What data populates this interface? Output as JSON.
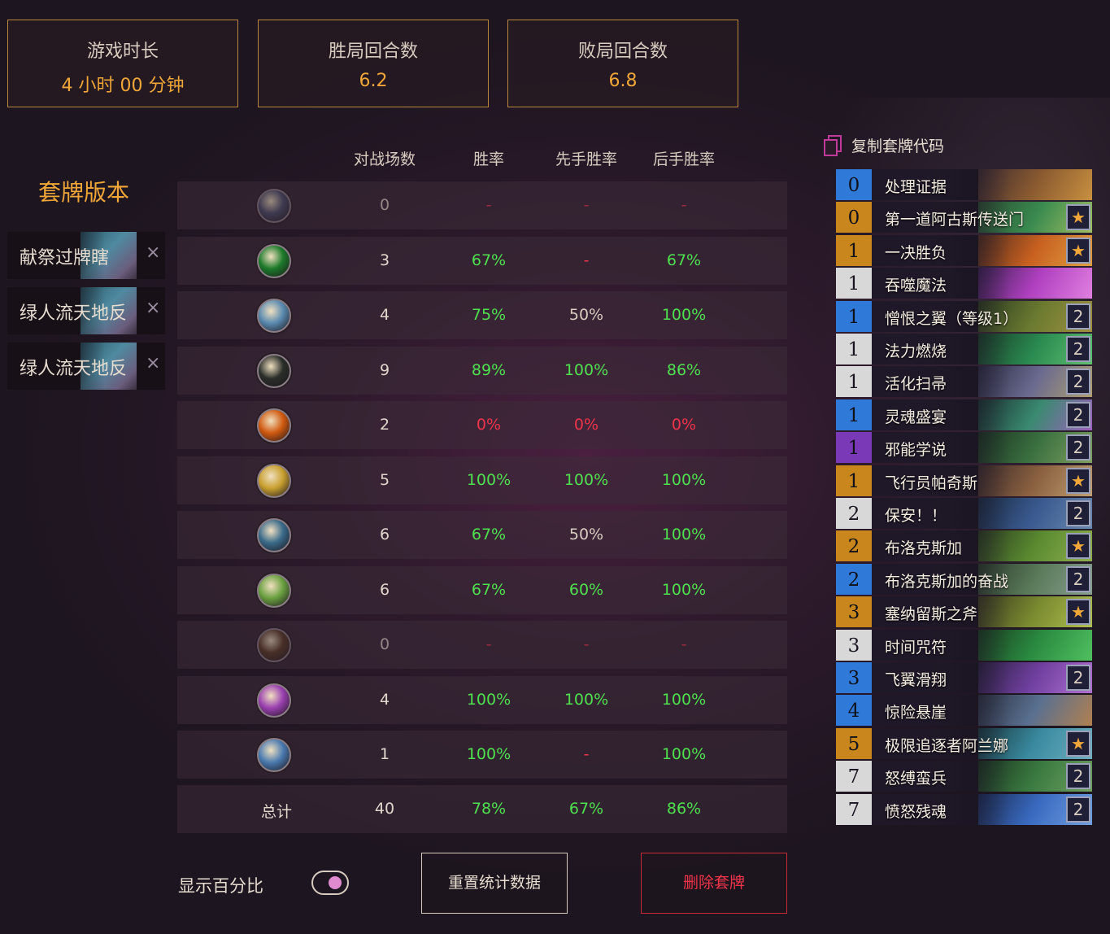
{
  "stats": {
    "duration": {
      "label": "游戏时长",
      "value": "4 小时 00 分钟"
    },
    "win_turns": {
      "label": "胜局回合数",
      "value": "6.2"
    },
    "loss_turns": {
      "label": "败局回合数",
      "value": "6.8"
    }
  },
  "versions": {
    "title": "套牌版本",
    "items": [
      {
        "name": "献祭过牌瞎"
      },
      {
        "name": "绿人流天地反"
      },
      {
        "name": "绿人流天地反"
      }
    ],
    "remove_glyph": "×"
  },
  "table": {
    "headers": {
      "games": "对战场数",
      "winrate": "胜率",
      "first": "先手胜率",
      "second": "后手胜率"
    },
    "rows": [
      {
        "icon": "death-knight-class-icon",
        "games": "0",
        "winrate": "-",
        "first": "-",
        "second": "-",
        "c_wr": "red",
        "c_first": "red",
        "c_second": "red",
        "dim": true
      },
      {
        "icon": "demon-hunter-class-icon",
        "games": "3",
        "winrate": "67%",
        "first": "-",
        "second": "67%",
        "c_wr": "green",
        "c_first": "red",
        "c_second": "green",
        "dim": false
      },
      {
        "icon": "druid-class-icon",
        "games": "4",
        "winrate": "75%",
        "first": "50%",
        "second": "100%",
        "c_wr": "green",
        "c_first": "gray",
        "c_second": "green",
        "dim": false
      },
      {
        "icon": "hunter-class-icon",
        "games": "9",
        "winrate": "89%",
        "first": "100%",
        "second": "86%",
        "c_wr": "green",
        "c_first": "green",
        "c_second": "green",
        "dim": false
      },
      {
        "icon": "mage-class-icon",
        "games": "2",
        "winrate": "0%",
        "first": "0%",
        "second": "0%",
        "c_wr": "red",
        "c_first": "red",
        "c_second": "red",
        "dim": false
      },
      {
        "icon": "paladin-class-icon",
        "games": "5",
        "winrate": "100%",
        "first": "100%",
        "second": "100%",
        "c_wr": "green",
        "c_first": "green",
        "c_second": "green",
        "dim": false
      },
      {
        "icon": "priest-class-icon",
        "games": "6",
        "winrate": "67%",
        "first": "50%",
        "second": "100%",
        "c_wr": "green",
        "c_first": "gray",
        "c_second": "green",
        "dim": false
      },
      {
        "icon": "shaman-class-icon",
        "games": "6",
        "winrate": "67%",
        "first": "60%",
        "second": "100%",
        "c_wr": "green",
        "c_first": "green",
        "c_second": "green",
        "dim": false
      },
      {
        "icon": "warlock-class-icon",
        "games": "0",
        "winrate": "-",
        "first": "-",
        "second": "-",
        "c_wr": "red",
        "c_first": "red",
        "c_second": "red",
        "dim": true
      },
      {
        "icon": "rogue-class-icon",
        "games": "4",
        "winrate": "100%",
        "first": "100%",
        "second": "100%",
        "c_wr": "green",
        "c_first": "green",
        "c_second": "green",
        "dim": false
      },
      {
        "icon": "warrior-class-icon",
        "games": "1",
        "winrate": "100%",
        "first": "-",
        "second": "100%",
        "c_wr": "green",
        "c_first": "red",
        "c_second": "green",
        "dim": false
      }
    ],
    "total": {
      "label": "总计",
      "games": "40",
      "winrate": "78%",
      "first": "67%",
      "second": "86%"
    }
  },
  "controls": {
    "show_percent_label": "显示百分比",
    "show_percent_on": true,
    "reset_label": "重置统计数据",
    "delete_label": "删除套牌"
  },
  "cards": {
    "copy_label": "复制套牌代码",
    "items": [
      {
        "cost": "0",
        "name": "处理证据",
        "rarity": "rare",
        "count": "",
        "art": [
          "#3a2a30",
          "#8a5a30",
          "#c89040"
        ]
      },
      {
        "cost": "0",
        "name": "第一道阿古斯传送门",
        "rarity": "legendary",
        "count": "★",
        "art": [
          "#2a4a30",
          "#3a8a50",
          "#a0c060"
        ]
      },
      {
        "cost": "1",
        "name": "一决胜负",
        "rarity": "legendary",
        "count": "★",
        "art": [
          "#4a2a20",
          "#c86020",
          "#e0a040"
        ]
      },
      {
        "cost": "1",
        "name": "吞噬魔法",
        "rarity": "common",
        "count": "",
        "art": [
          "#3a2050",
          "#b040c0",
          "#e080e0"
        ]
      },
      {
        "cost": "1",
        "name": "憎恨之翼（等级1）",
        "rarity": "rare",
        "count": "2",
        "art": [
          "#2a3a20",
          "#6a7a30",
          "#a09040"
        ]
      },
      {
        "cost": "1",
        "name": "法力燃烧",
        "rarity": "common",
        "count": "2",
        "art": [
          "#1a3a28",
          "#2a8a50",
          "#60c070"
        ]
      },
      {
        "cost": "1",
        "name": "活化扫帚",
        "rarity": "common",
        "count": "2",
        "art": [
          "#2a2a40",
          "#6a6a90",
          "#b0a070"
        ]
      },
      {
        "cost": "1",
        "name": "灵魂盛宴",
        "rarity": "rare",
        "count": "2",
        "art": [
          "#1a3030",
          "#3a8a70",
          "#a060c0"
        ]
      },
      {
        "cost": "1",
        "name": "邪能学说",
        "rarity": "epic",
        "count": "2",
        "art": [
          "#1a3020",
          "#3a7040",
          "#80a060"
        ]
      },
      {
        "cost": "1",
        "name": "飞行员帕奇斯",
        "rarity": "legendary",
        "count": "★",
        "art": [
          "#3a2a2a",
          "#8a6040",
          "#c0a070"
        ]
      },
      {
        "cost": "2",
        "name": "保安！！",
        "rarity": "common",
        "count": "2",
        "art": [
          "#1a2a40",
          "#3a5a90",
          "#6a8ab0"
        ]
      },
      {
        "cost": "2",
        "name": "布洛克斯加",
        "rarity": "legendary",
        "count": "★",
        "art": [
          "#2a3a20",
          "#5a8a30",
          "#90b050"
        ]
      },
      {
        "cost": "2",
        "name": "布洛克斯加的奋战",
        "rarity": "rare",
        "count": "2",
        "art": [
          "#2a3a2a",
          "#5a7a5a",
          "#8aa090"
        ]
      },
      {
        "cost": "3",
        "name": "塞纳留斯之斧",
        "rarity": "legendary",
        "count": "★",
        "art": [
          "#3a3a20",
          "#7a8a30",
          "#b0c050"
        ]
      },
      {
        "cost": "3",
        "name": "时间咒符",
        "rarity": "common",
        "count": "",
        "art": [
          "#1a3a20",
          "#2a8a40",
          "#50c060"
        ]
      },
      {
        "cost": "3",
        "name": "飞翼滑翔",
        "rarity": "rare",
        "count": "2",
        "art": [
          "#2a2040",
          "#7040a0",
          "#b070d0"
        ]
      },
      {
        "cost": "4",
        "name": "惊险悬崖",
        "rarity": "rare",
        "count": "",
        "art": [
          "#2a3040",
          "#5a7090",
          "#b08050"
        ]
      },
      {
        "cost": "5",
        "name": "极限追逐者阿兰娜",
        "rarity": "legendary",
        "count": "★",
        "art": [
          "#1a3a40",
          "#3a8aa0",
          "#70b0c0"
        ]
      },
      {
        "cost": "7",
        "name": "怒缚蛮兵",
        "rarity": "common",
        "count": "2",
        "art": [
          "#1a3020",
          "#3a7a40",
          "#70a060"
        ]
      },
      {
        "cost": "7",
        "name": "愤怒残魂",
        "rarity": "common",
        "count": "2",
        "art": [
          "#1a2a50",
          "#3a6ac0",
          "#70a0e0"
        ]
      }
    ]
  },
  "colors": {
    "accent": "#f0a638",
    "win": "#4fe04f",
    "loss": "#f0344a",
    "rarity_common": "#d8d8d8",
    "rarity_rare": "#2f7ad8",
    "rarity_epic": "#7a3ab8",
    "rarity_legendary": "#c8861c",
    "class_icons": {
      "death-knight-class-icon": "#4a4e6a",
      "demon-hunter-class-icon": "#1c7a2a",
      "druid-class-icon": "#5a8ab0",
      "hunter-class-icon": "#2a2e2a",
      "mage-class-icon": "#d05a10",
      "paladin-class-icon": "#c8a030",
      "priest-class-icon": "#3a6a8a",
      "shaman-class-icon": "#6aa040",
      "warlock-class-icon": "#5a3a20",
      "rogue-class-icon": "#9a40b0",
      "warrior-class-icon": "#4a7ab0"
    }
  }
}
